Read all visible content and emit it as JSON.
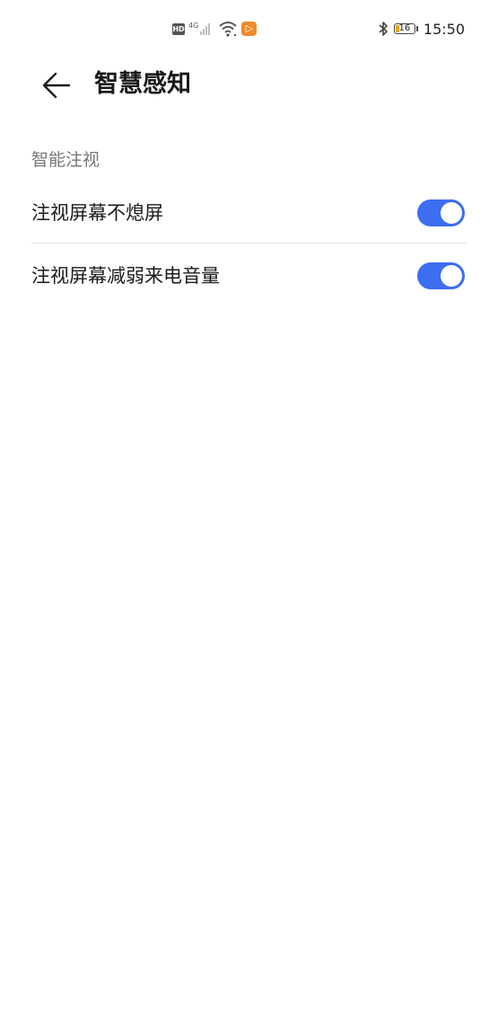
{
  "status_bar": {
    "hd_label": "HD",
    "network_label": "4G",
    "battery_level": "16",
    "time": "15:50",
    "icons": [
      "hd-icon",
      "signal-icon",
      "wifi-icon",
      "app-notification-icon",
      "bluetooth-icon",
      "battery-icon"
    ]
  },
  "header": {
    "title": "智慧感知",
    "back_icon": "arrow-left-icon"
  },
  "section": {
    "title": "智能注视",
    "items": [
      {
        "label": "注视屏幕不熄屏",
        "toggle_on": true
      },
      {
        "label": "注视屏幕减弱来电音量",
        "toggle_on": true
      }
    ]
  },
  "colors": {
    "accent": "#3b6ef0",
    "divider": "#e4e4e4",
    "section_text": "#777777",
    "primary_text": "#1a1a1a",
    "app_badge": "#f08a2a",
    "battery_fill": "#e6a817"
  }
}
